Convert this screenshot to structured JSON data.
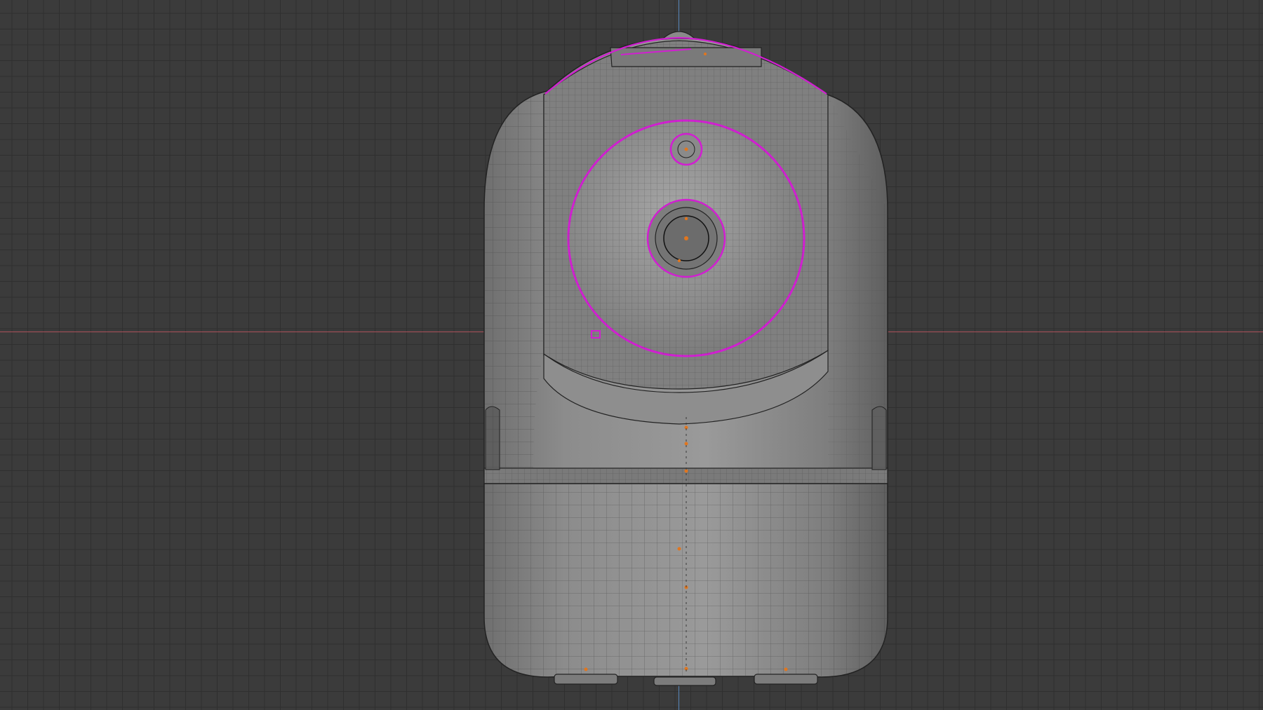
{
  "viewport": {
    "background": "#3b3b3b",
    "grid_color": "#2f2f2f",
    "axis_x_color": "#b8545e",
    "axis_z_color": "#5b8fc9"
  },
  "model": {
    "name": "",
    "body_color": "#8a8a8a",
    "wire_color": "#2a2a2a",
    "selection_color": "#d11fd1",
    "vertex_color": "#e0761f"
  }
}
